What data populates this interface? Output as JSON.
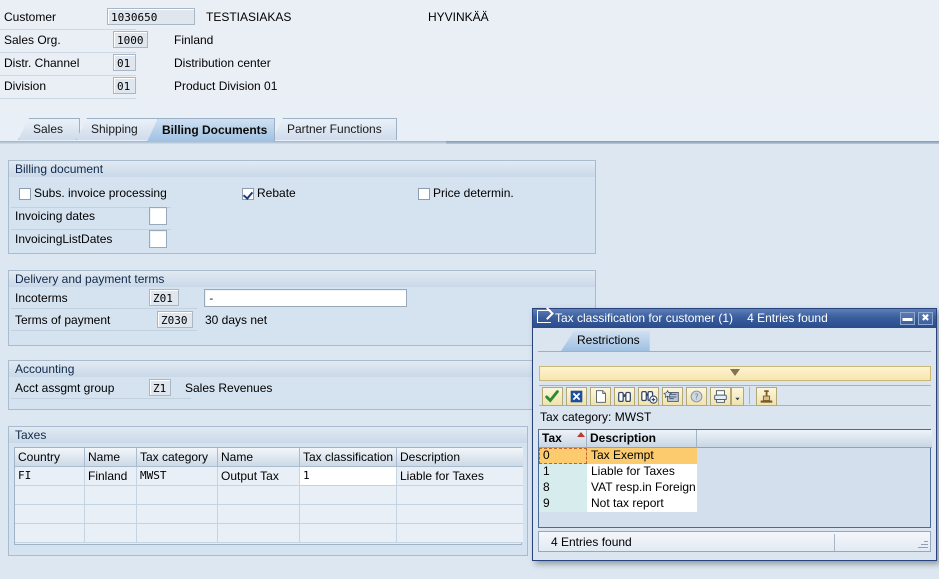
{
  "header": {
    "rows": [
      {
        "label": "Customer",
        "value": "1030650",
        "desc": "TESTIASIAKAS",
        "desc2": "HYVINKÄÄ"
      },
      {
        "label": "Sales Org.",
        "value": "1000",
        "desc": "Finland",
        "desc2": ""
      },
      {
        "label": "Distr. Channel",
        "value": "01",
        "desc": "Distribution center",
        "desc2": ""
      },
      {
        "label": "Division",
        "value": "01",
        "desc": "Product Division 01",
        "desc2": ""
      }
    ]
  },
  "tabs": [
    {
      "label": "Sales",
      "active": false
    },
    {
      "label": "Shipping",
      "active": false
    },
    {
      "label": "Billing Documents",
      "active": true
    },
    {
      "label": "Partner Functions",
      "active": false
    }
  ],
  "billing_document": {
    "title": "Billing document",
    "checkboxes": [
      {
        "label": "Subs. invoice processing",
        "checked": false
      },
      {
        "label": "Rebate",
        "checked": true
      },
      {
        "label": "Price determin.",
        "checked": false
      }
    ],
    "fields": [
      {
        "label": "Invoicing dates",
        "value": ""
      },
      {
        "label": "InvoicingListDates",
        "value": ""
      }
    ]
  },
  "delivery_payment": {
    "title": "Delivery and payment terms",
    "rows": [
      {
        "label": "Incoterms",
        "code": "Z01",
        "desc": "-"
      },
      {
        "label": "Terms of payment",
        "code": "Z030",
        "desc": "30 days net"
      }
    ]
  },
  "accounting": {
    "title": "Accounting",
    "rows": [
      {
        "label": "Acct assgmt group",
        "code": "Z1",
        "desc": "Sales Revenues"
      }
    ]
  },
  "taxes": {
    "title": "Taxes",
    "columns": [
      "Country",
      "Name",
      "Tax category",
      "Name",
      "Tax classification",
      "Description"
    ],
    "rows": [
      [
        "FI",
        "Finland",
        "MWST",
        "Output Tax",
        "1",
        "Liable for Taxes"
      ],
      [
        "",
        "",
        "",
        "",
        "",
        ""
      ],
      [
        "",
        "",
        "",
        "",
        "",
        ""
      ],
      [
        "",
        "",
        "",
        "",
        "",
        ""
      ]
    ]
  },
  "dialog": {
    "title": "Tax classification for customer (1)",
    "title_count": "4 Entries found",
    "title_icon": "export-icon",
    "window_buttons": [
      {
        "name": "minimize-button",
        "glyph": "▬"
      },
      {
        "name": "close-button",
        "glyph": "✖"
      }
    ],
    "tab_label": "Restrictions",
    "toolbar": [
      {
        "name": "check-button",
        "icon": "green-check-icon"
      },
      {
        "name": "cancel-button",
        "icon": "blue-x-icon"
      },
      {
        "name": "new-selection-button",
        "icon": "blank-page-icon"
      },
      {
        "name": "find-button",
        "icon": "binoculars-icon"
      },
      {
        "name": "find-next-button",
        "icon": "binoculars-plus-icon"
      },
      {
        "name": "personal-list-button",
        "icon": "star-list-icon"
      },
      {
        "name": "help-button",
        "icon": "help-globe-icon"
      },
      {
        "name": "print-button",
        "icon": "printer-icon"
      },
      {
        "name": "print-menu-button",
        "icon": "chevron-down-icon"
      },
      {
        "name": "sort-button",
        "icon": "stamp-icon"
      }
    ],
    "category_line": "Tax category: MWST",
    "list_columns": [
      "Tax",
      "Description"
    ],
    "list_rows": [
      {
        "key": "0",
        "desc": "Tax Exempt",
        "selected": true
      },
      {
        "key": "1",
        "desc": "Liable for Taxes",
        "selected": false
      },
      {
        "key": "8",
        "desc": "VAT resp.in Foreign",
        "selected": false
      },
      {
        "key": "9",
        "desc": "Not tax report",
        "selected": false
      }
    ],
    "status": "4 Entries found"
  },
  "colors": {
    "page_bg": "#e9eff6",
    "body_bg": "#dde7f1",
    "group_bg": "#d5e2ef",
    "accent": "#2a4c8d",
    "selected_row": "#fbcb6e",
    "key_cell": "#d7ecec"
  }
}
